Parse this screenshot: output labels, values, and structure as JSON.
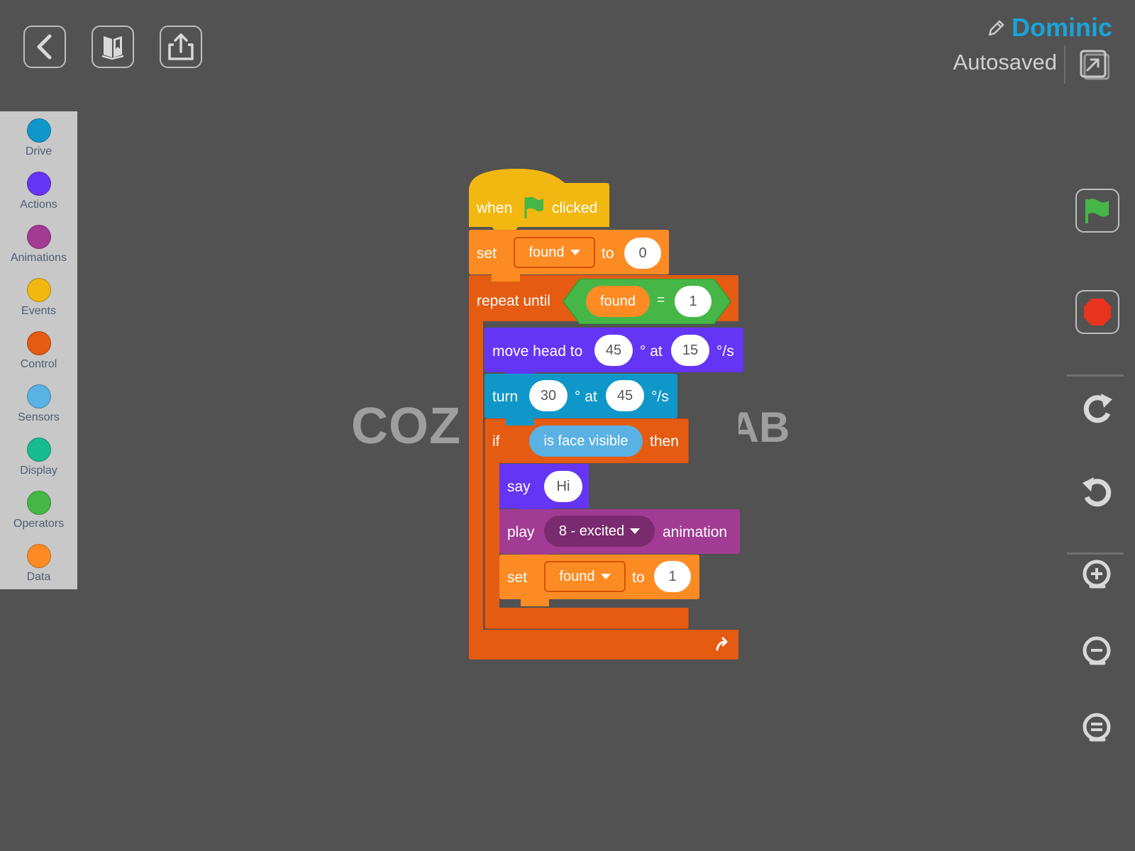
{
  "toolbar": {
    "back_icon": "back-chevron-icon",
    "library_icon": "book-icon",
    "share_icon": "share-icon"
  },
  "header": {
    "user_name": "Dominic",
    "autosave_status": "Autosaved"
  },
  "palette": {
    "categories": [
      {
        "label": "Drive",
        "color": "#0f97c9"
      },
      {
        "label": "Actions",
        "color": "#6535f5"
      },
      {
        "label": "Animations",
        "color": "#a23b93"
      },
      {
        "label": "Events",
        "color": "#f2b711"
      },
      {
        "label": "Control",
        "color": "#e45b11"
      },
      {
        "label": "Sensors",
        "color": "#5ab1e3"
      },
      {
        "label": "Display",
        "color": "#17bd8e"
      },
      {
        "label": "Operators",
        "color": "#46b747"
      },
      {
        "label": "Data",
        "color": "#fd8b23"
      }
    ]
  },
  "watermark": {
    "left": "COZ",
    "right": "LAB"
  },
  "script": {
    "hat": {
      "when": "when",
      "clicked": "clicked"
    },
    "set1": {
      "keyword": "set",
      "variable": "found",
      "to": "to",
      "value": "0"
    },
    "repeat": {
      "keyword": "repeat until",
      "variable": "found",
      "op": "=",
      "value": "1"
    },
    "move_head": {
      "keyword": "move head to",
      "angle": "45",
      "deg_at": "° at",
      "speed": "15",
      "unit": "°/s"
    },
    "turn": {
      "keyword": "turn",
      "angle": "30",
      "deg_at": "° at",
      "speed": "45",
      "unit": "°/s"
    },
    "if": {
      "keyword": "if",
      "condition": "is face visible",
      "then": "then"
    },
    "say": {
      "keyword": "say",
      "text": "Hi"
    },
    "play": {
      "keyword": "play",
      "animation": "8 - excited",
      "suffix": "animation"
    },
    "set2": {
      "keyword": "set",
      "variable": "found",
      "to": "to",
      "value": "1"
    }
  },
  "colors": {
    "events": "#f2b711",
    "data": "#fd8b23",
    "control": "#e45b11",
    "actions": "#6535f5",
    "drive": "#0f97c9",
    "sensors": "#5ab1e3",
    "operators": "#46b747",
    "animations": "#a23b93",
    "user": "#1aa3d8"
  },
  "right_toolbar": {
    "icons": [
      "green-flag-icon",
      "stop-icon",
      "redo-icon",
      "undo-icon",
      "zoom-in-icon",
      "zoom-out-icon",
      "zoom-reset-icon"
    ]
  }
}
